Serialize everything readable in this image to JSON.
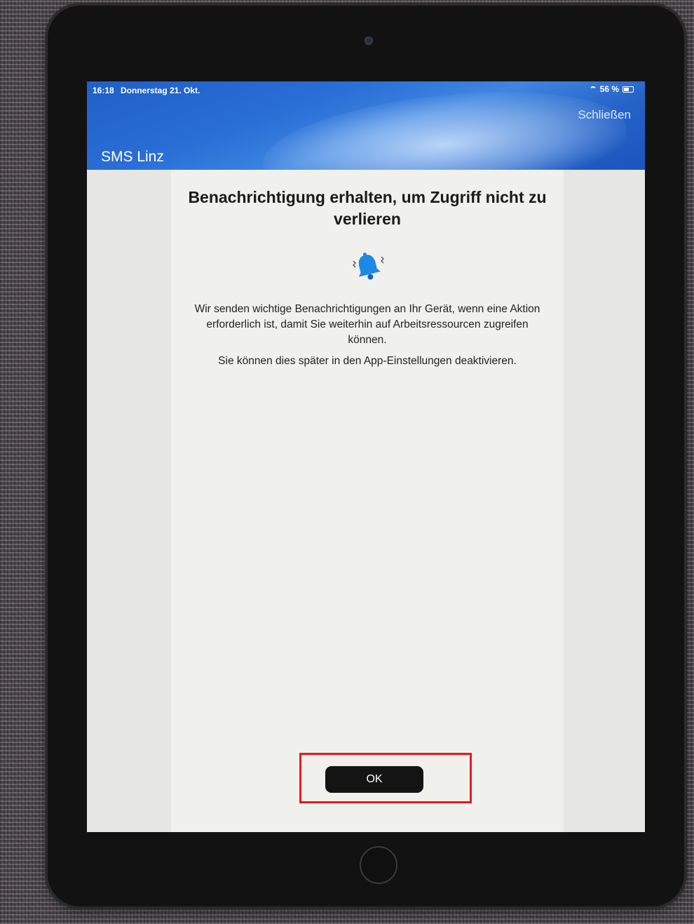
{
  "status_bar": {
    "time": "16:18",
    "date": "Donnerstag 21. Okt.",
    "battery": "56 %"
  },
  "header": {
    "close_label": "Schließen",
    "title": "SMS Linz"
  },
  "content": {
    "heading": "Benachrichtigung erhalten, um Zugriff nicht zu verlieren",
    "body": "Wir senden wichtige Benachrichtigungen an Ihr Gerät, wenn eine Aktion erforderlich ist, damit Sie weiterhin auf Arbeitsressourcen zugreifen können.",
    "note": "Sie können dies später in den App-Einstellungen deaktivieren.",
    "ok_label": "OK",
    "icon": "bell-icon"
  },
  "colors": {
    "header_blue": "#2a6fd6",
    "button_dark": "#141414",
    "highlight_red": "#e51c1c",
    "bell_blue": "#1e88e5"
  }
}
